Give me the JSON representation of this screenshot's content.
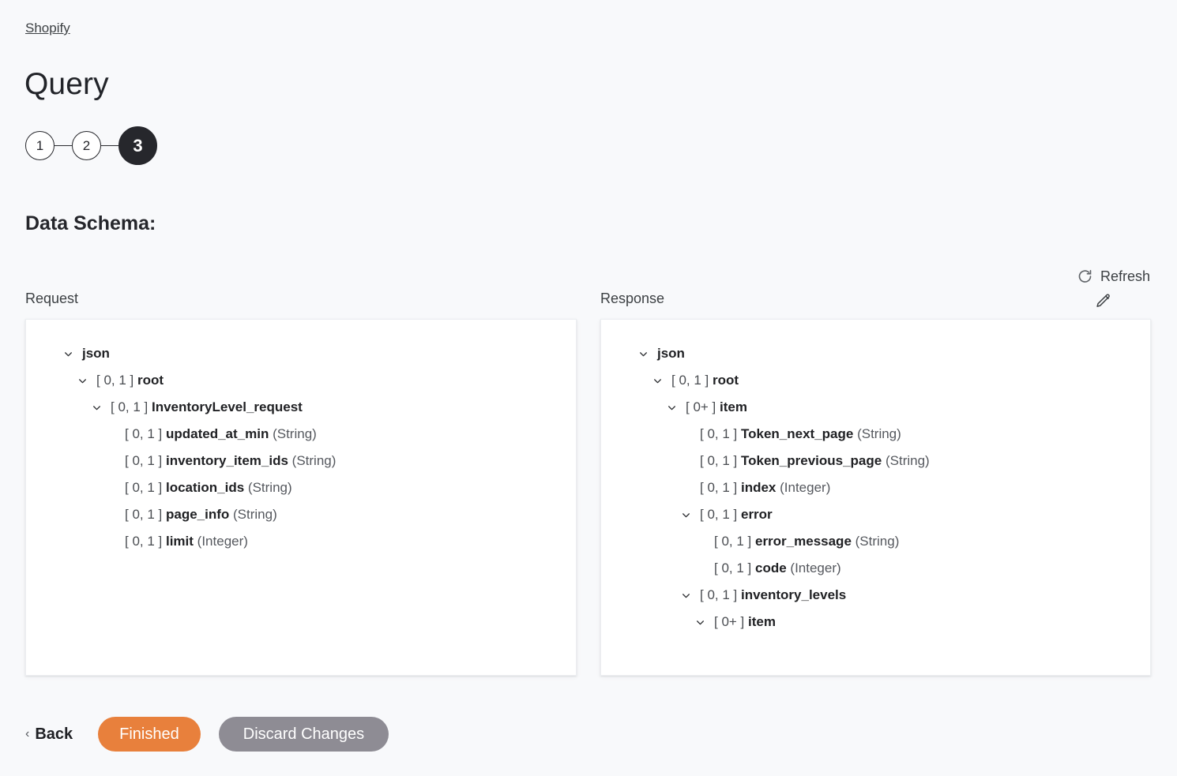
{
  "breadcrumb": {
    "label": "Shopify"
  },
  "header": {
    "title": "Query"
  },
  "stepper": {
    "steps": [
      {
        "label": "1",
        "state": "complete"
      },
      {
        "label": "2",
        "state": "complete"
      },
      {
        "label": "3",
        "state": "current"
      }
    ]
  },
  "section": {
    "heading": "Data Schema:"
  },
  "toolbar": {
    "refresh_label": "Refresh",
    "refresh_icon": "refresh-icon",
    "edit_icon": "pencil-edit-icon"
  },
  "colors": {
    "page_background": "#f8f9fb",
    "panel_background": "#ffffff",
    "accent_primary": "#e8803c",
    "accent_secondary": "#8e8c94",
    "step_active": "#26272c",
    "text_primary": "#202124",
    "text_secondary": "#3c4043"
  },
  "panels": {
    "request": {
      "label": "Request",
      "nodes": [
        {
          "indent": 0,
          "expandable": true,
          "multiplicity": "",
          "name": "json",
          "type": ""
        },
        {
          "indent": 1,
          "expandable": true,
          "multiplicity": "[ 0, 1 ]",
          "name": "root",
          "type": ""
        },
        {
          "indent": 2,
          "expandable": true,
          "multiplicity": "[ 0, 1 ]",
          "name": "InventoryLevel_request",
          "type": ""
        },
        {
          "indent": 3,
          "expandable": false,
          "multiplicity": "[ 0, 1 ]",
          "name": "updated_at_min",
          "type": "(String)"
        },
        {
          "indent": 3,
          "expandable": false,
          "multiplicity": "[ 0, 1 ]",
          "name": "inventory_item_ids",
          "type": "(String)"
        },
        {
          "indent": 3,
          "expandable": false,
          "multiplicity": "[ 0, 1 ]",
          "name": "location_ids",
          "type": "(String)"
        },
        {
          "indent": 3,
          "expandable": false,
          "multiplicity": "[ 0, 1 ]",
          "name": "page_info",
          "type": "(String)"
        },
        {
          "indent": 3,
          "expandable": false,
          "multiplicity": "[ 0, 1 ]",
          "name": "limit",
          "type": "(Integer)"
        }
      ]
    },
    "response": {
      "label": "Response",
      "nodes": [
        {
          "indent": 0,
          "expandable": true,
          "multiplicity": "",
          "name": "json",
          "type": ""
        },
        {
          "indent": 1,
          "expandable": true,
          "multiplicity": "[ 0, 1 ]",
          "name": "root",
          "type": ""
        },
        {
          "indent": 2,
          "expandable": true,
          "multiplicity": "[ 0+ ]",
          "name": "item",
          "type": ""
        },
        {
          "indent": 3,
          "expandable": false,
          "multiplicity": "[ 0, 1 ]",
          "name": "Token_next_page",
          "type": "(String)"
        },
        {
          "indent": 3,
          "expandable": false,
          "multiplicity": "[ 0, 1 ]",
          "name": "Token_previous_page",
          "type": "(String)"
        },
        {
          "indent": 3,
          "expandable": false,
          "multiplicity": "[ 0, 1 ]",
          "name": "index",
          "type": "(Integer)"
        },
        {
          "indent": 3,
          "expandable": true,
          "multiplicity": "[ 0, 1 ]",
          "name": "error",
          "type": ""
        },
        {
          "indent": 4,
          "expandable": false,
          "multiplicity": "[ 0, 1 ]",
          "name": "error_message",
          "type": "(String)"
        },
        {
          "indent": 4,
          "expandable": false,
          "multiplicity": "[ 0, 1 ]",
          "name": "code",
          "type": "(Integer)"
        },
        {
          "indent": 3,
          "expandable": true,
          "multiplicity": "[ 0, 1 ]",
          "name": "inventory_levels",
          "type": ""
        },
        {
          "indent": 4,
          "expandable": true,
          "multiplicity": "[ 0+ ]",
          "name": "item",
          "type": ""
        }
      ]
    }
  },
  "footer": {
    "back_label": "Back",
    "back_chevron": "chevron-left-icon",
    "finished_label": "Finished",
    "discard_label": "Discard Changes"
  }
}
